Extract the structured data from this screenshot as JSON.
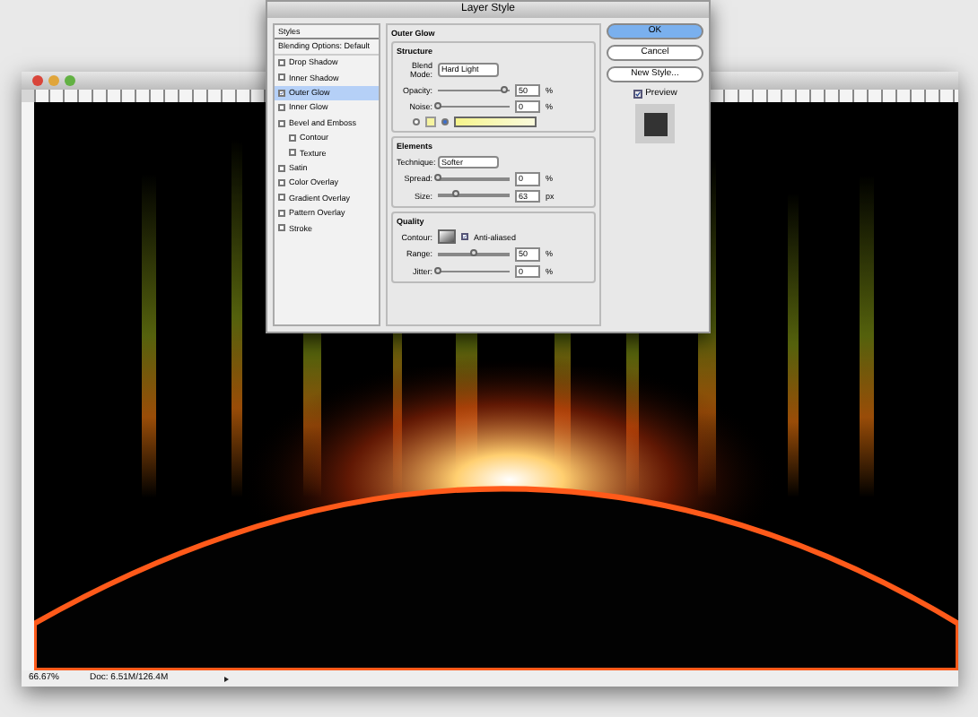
{
  "document": {
    "zoom": "66.67%",
    "doc_info": "Doc: 6.51M/126.4M"
  },
  "dialog": {
    "title": "Layer Style",
    "styles_header": "Styles",
    "blending_options": "Blending Options: Default",
    "effects": [
      {
        "label": "Drop Shadow",
        "checked": false,
        "selected": false
      },
      {
        "label": "Inner Shadow",
        "checked": false,
        "selected": false
      },
      {
        "label": "Outer Glow",
        "checked": true,
        "selected": true
      },
      {
        "label": "Inner Glow",
        "checked": false,
        "selected": false
      },
      {
        "label": "Bevel and Emboss",
        "checked": false,
        "selected": false,
        "children": [
          {
            "label": "Contour",
            "checked": false,
            "selected": false
          },
          {
            "label": "Texture",
            "checked": false,
            "selected": false
          }
        ]
      },
      {
        "label": "Satin",
        "checked": false,
        "selected": false
      },
      {
        "label": "Color Overlay",
        "checked": false,
        "selected": false
      },
      {
        "label": "Gradient Overlay",
        "checked": false,
        "selected": false
      },
      {
        "label": "Pattern Overlay",
        "checked": false,
        "selected": false
      },
      {
        "label": "Stroke",
        "checked": false,
        "selected": false
      }
    ],
    "panel_title": "Outer Glow",
    "sections": [
      {
        "title": "Structure",
        "rows": [
          {
            "kind": "select",
            "label": "Blend Mode:",
            "value": "Hard Light"
          },
          {
            "kind": "slider",
            "label": "Opacity:",
            "value": "50",
            "unit": "%",
            "level": 0.92
          },
          {
            "kind": "slider",
            "label": "Noise:",
            "value": "0",
            "unit": "%",
            "level": 0
          },
          {
            "kind": "color",
            "solid_selected": false,
            "gradient_selected": true
          }
        ]
      },
      {
        "title": "Elements",
        "rows": [
          {
            "kind": "select",
            "label": "Technique:",
            "value": "Softer"
          },
          {
            "kind": "slider",
            "label": "Spread:",
            "value": "0",
            "unit": "%",
            "level": 0
          },
          {
            "kind": "slider",
            "label": "Size:",
            "value": "63",
            "unit": "px",
            "level": 0.25
          }
        ]
      },
      {
        "title": "Quality",
        "rows": [
          {
            "kind": "contour",
            "label": "Contour:",
            "option": "Anti-aliased",
            "checked": true
          },
          {
            "kind": "slider",
            "label": "Range:",
            "value": "50",
            "unit": "%",
            "level": 0.5
          },
          {
            "kind": "slider",
            "label": "Jitter:",
            "value": "0",
            "unit": "%",
            "level": 0
          }
        ]
      }
    ],
    "buttons": [
      {
        "label": "OK",
        "default": true
      },
      {
        "label": "Cancel",
        "default": false
      },
      {
        "label": "New Style...",
        "default": false
      }
    ],
    "preview": {
      "label": "Preview",
      "checked": true
    }
  }
}
